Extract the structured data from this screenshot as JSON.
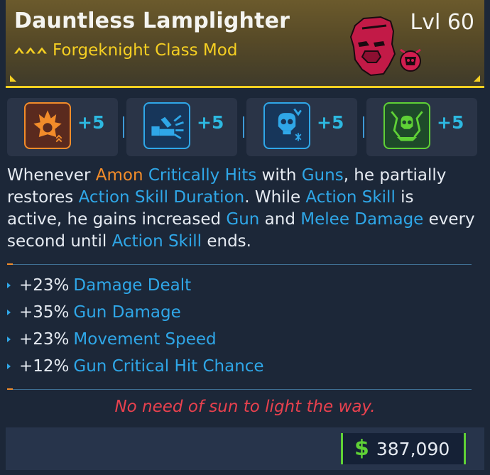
{
  "item": {
    "name": "Dauntless Lamplighter",
    "type": "Forgeknight Class Mod",
    "level": "Lvl 60",
    "rarity_color": "#f5cf22"
  },
  "skills": [
    {
      "icon": "fire-skill-icon",
      "color": "#f28c2a",
      "bonus": "+5"
    },
    {
      "icon": "forge-skill-icon",
      "color": "#2fa7e8",
      "bonus": "+5"
    },
    {
      "icon": "frost-skull-skill-icon",
      "color": "#2fa7e8",
      "bonus": "+5"
    },
    {
      "icon": "skull-shield-skill-icon",
      "color": "#5fd136",
      "bonus": "+5"
    }
  ],
  "description": {
    "line1": [
      "Whenever ",
      "Amon",
      " ",
      "Critically Hits",
      " with ",
      "Guns",
      ", he partially"
    ],
    "line2": [
      "restores ",
      "Action Skill Duration",
      ". While ",
      "Action Skill",
      " is"
    ],
    "line3": [
      "active, he gains increased ",
      "Gun",
      " and ",
      "Melee Damage",
      " every"
    ],
    "line4": [
      "second until ",
      "Action Skill",
      " ends."
    ]
  },
  "stats": [
    {
      "value": "+23%",
      "label": "Damage Dealt"
    },
    {
      "value": "+35%",
      "label": "Gun Damage"
    },
    {
      "value": "+23%",
      "label": "Movement Speed"
    },
    {
      "value": "+12%",
      "label": "Gun Critical Hit Chance"
    }
  ],
  "flavor_text": "No need of sun to light the way.",
  "price": {
    "currency_icon": "dollar-icon",
    "symbol": "$",
    "value": "387,090"
  }
}
